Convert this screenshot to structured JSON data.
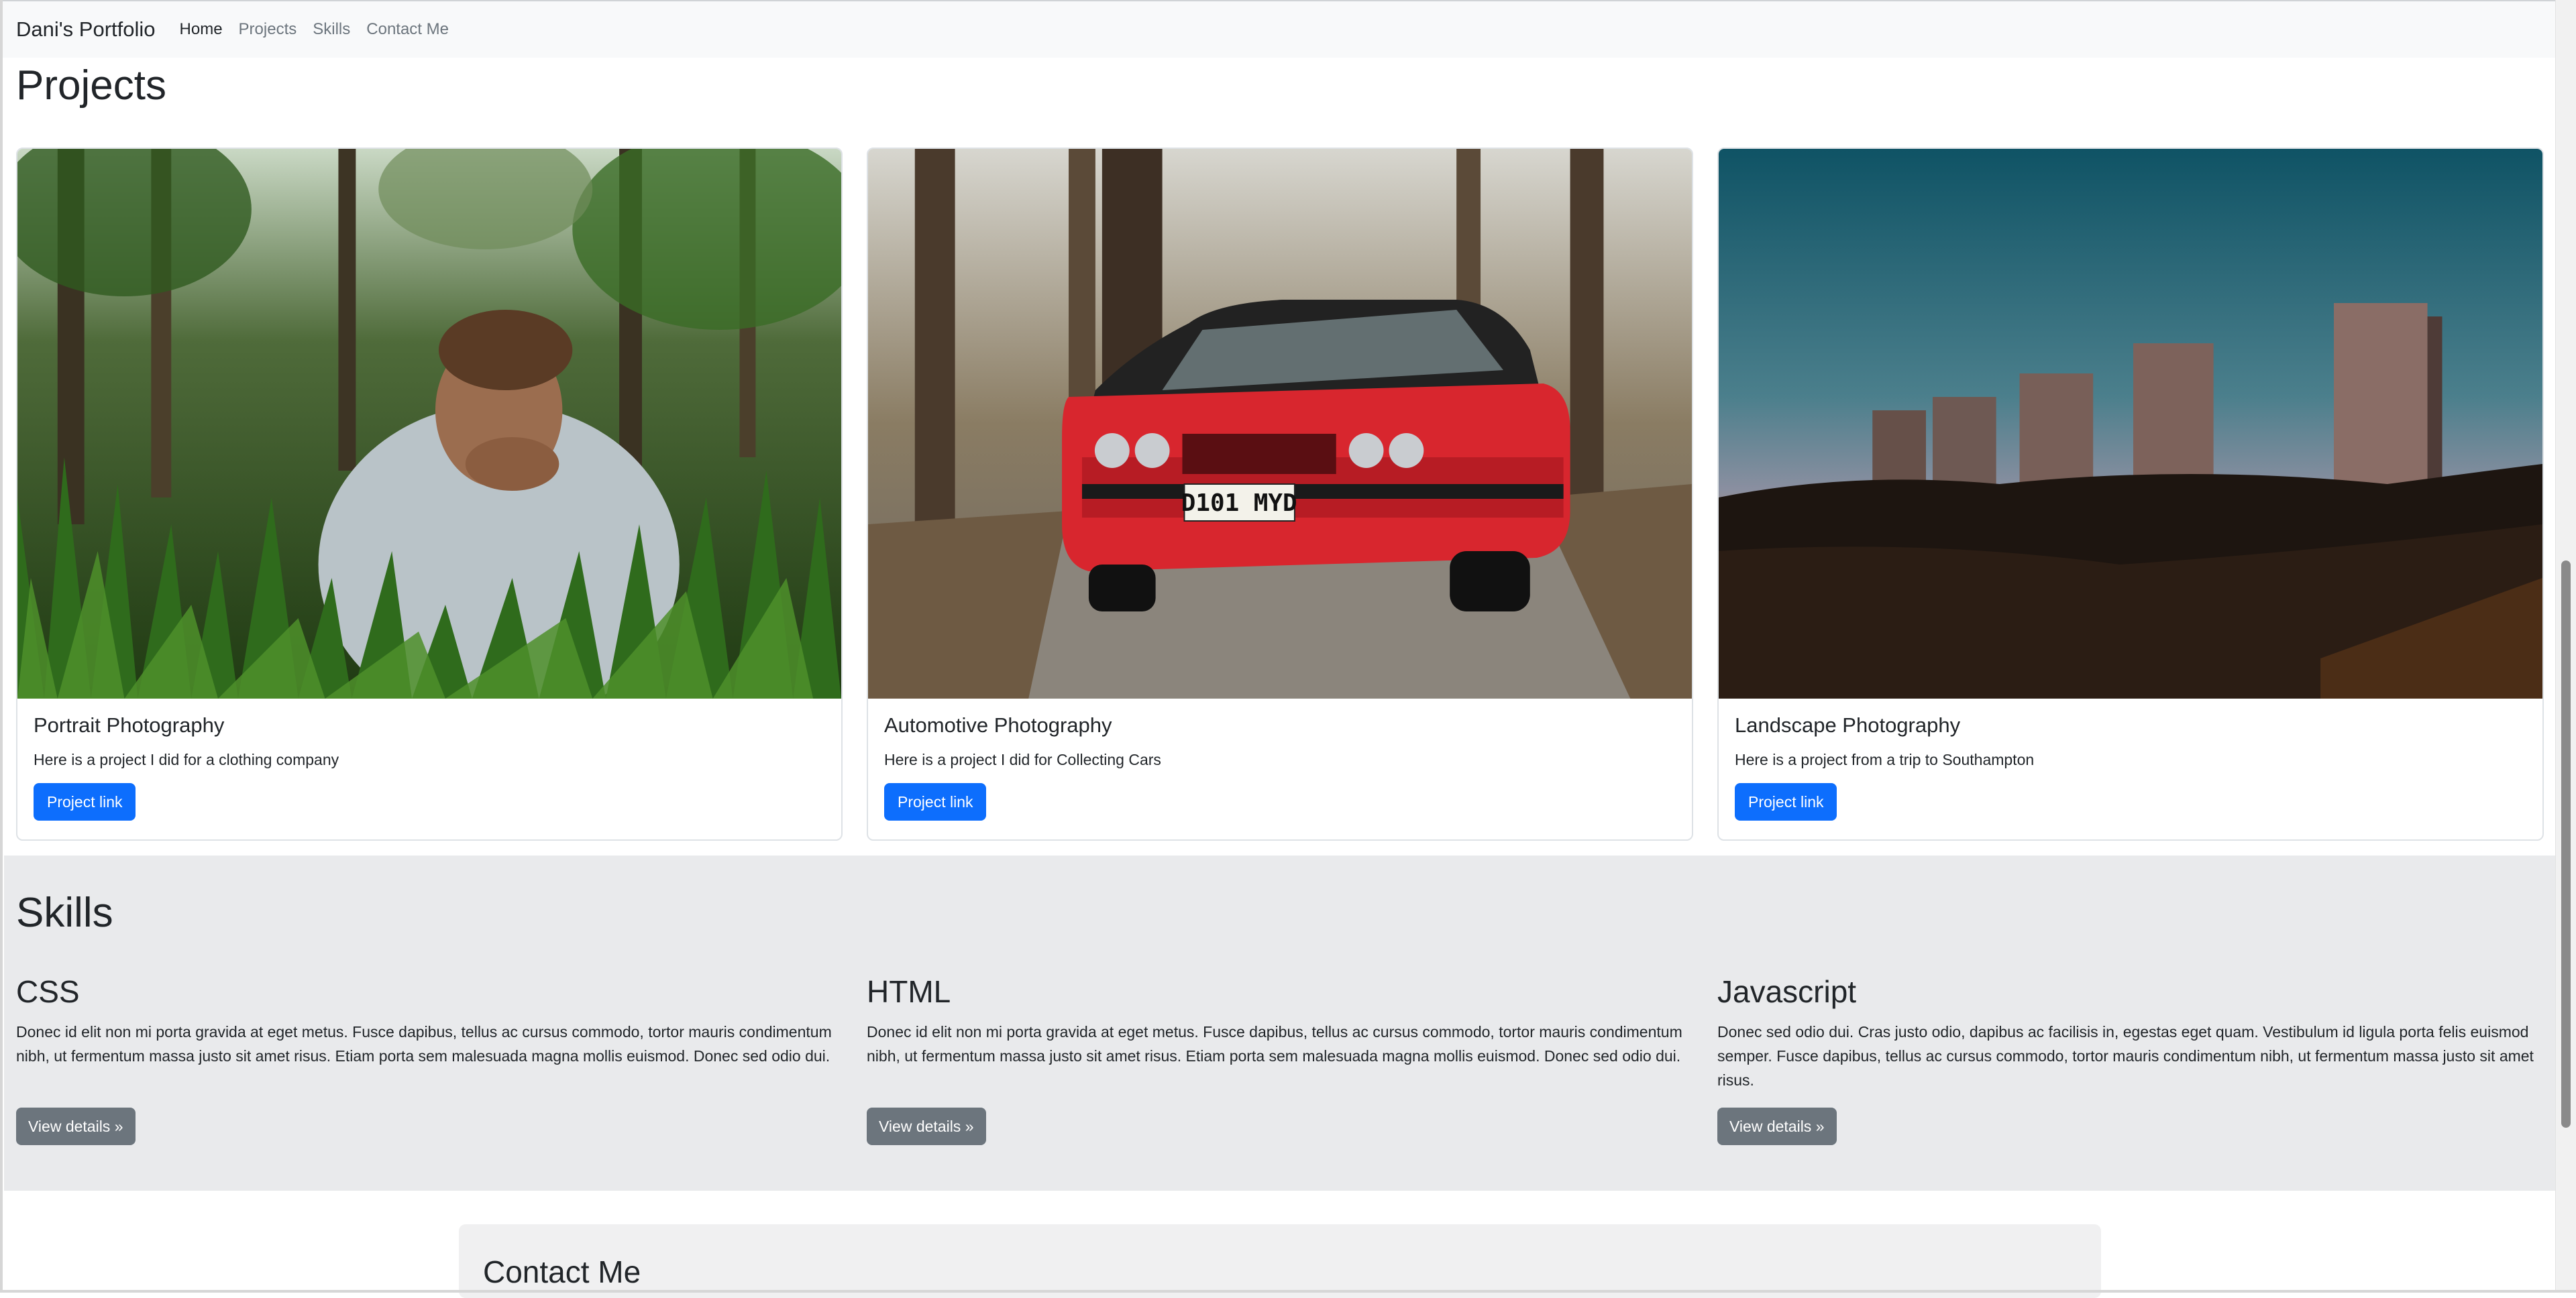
{
  "navbar": {
    "brand": "Dani's Portfolio",
    "links": [
      {
        "label": "Home",
        "active": true
      },
      {
        "label": "Projects",
        "active": false
      },
      {
        "label": "Skills",
        "active": false
      },
      {
        "label": "Contact Me",
        "active": false
      }
    ]
  },
  "projects": {
    "title": "Projects",
    "cards": [
      {
        "title": "Portrait Photography",
        "text": "Here is a project I did for a clothing company",
        "button": "Project link",
        "image": "portrait-photo"
      },
      {
        "title": "Automotive Photography",
        "text": "Here is a project I did for Collecting Cars",
        "button": "Project link",
        "image": "red-car-photo",
        "plate": "D101 MYD"
      },
      {
        "title": "Landscape Photography",
        "text": "Here is a project from a trip to Southampton",
        "button": "Project link",
        "image": "tower-blocks-photo"
      }
    ]
  },
  "skills": {
    "title": "Skills",
    "items": [
      {
        "title": "CSS",
        "text": "Donec id elit non mi porta gravida at eget metus. Fusce dapibus, tellus ac cursus commodo, tortor mauris condimentum nibh, ut fermentum massa justo sit amet risus. Etiam porta sem malesuada magna mollis euismod. Donec sed odio dui.",
        "button": "View details »"
      },
      {
        "title": "HTML",
        "text": "Donec id elit non mi porta gravida at eget metus. Fusce dapibus, tellus ac cursus commodo, tortor mauris condimentum nibh, ut fermentum massa justo sit amet risus. Etiam porta sem malesuada magna mollis euismod. Donec sed odio dui.",
        "button": "View details »"
      },
      {
        "title": "Javascript",
        "text": "Donec sed odio dui. Cras justo odio, dapibus ac facilisis in, egestas eget quam. Vestibulum id ligula porta felis euismod semper. Fusce dapibus, tellus ac cursus commodo, tortor mauris condimentum nibh, ut fermentum massa justo sit amet risus.",
        "button": "View details »"
      }
    ]
  },
  "contact": {
    "title": "Contact Me"
  },
  "colors": {
    "primary": "#0d6efd",
    "secondary": "#6c757d",
    "navbar_bg": "#f8f9fa",
    "skills_bg": "#e9eaec"
  }
}
